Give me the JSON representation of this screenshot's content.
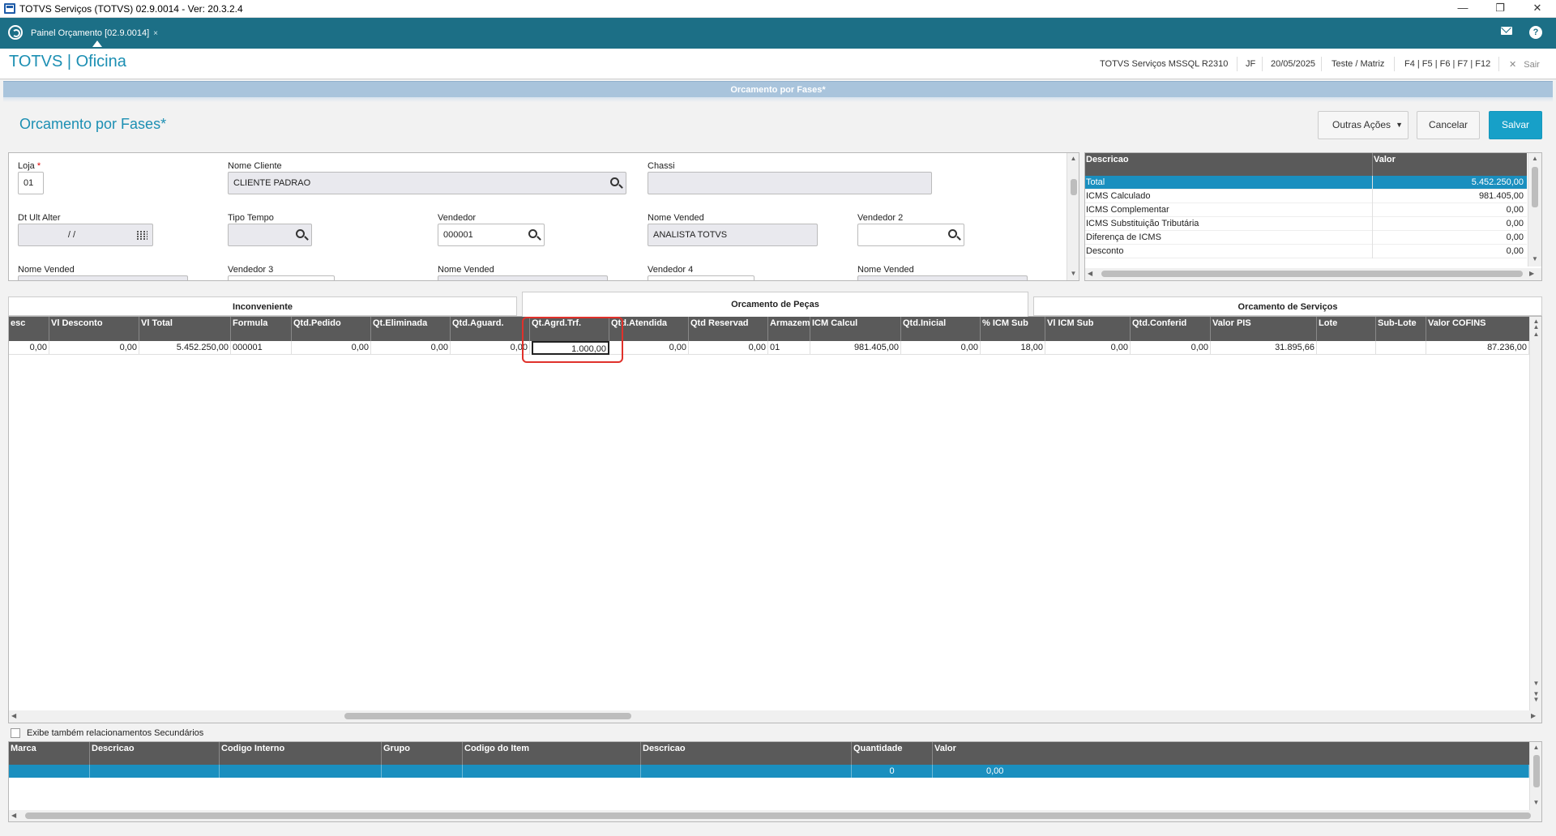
{
  "window": {
    "title": "TOTVS Serviços (TOTVS) 02.9.0014 - Ver: 20.3.2.4",
    "minimize": "—",
    "maximize": "❐",
    "close": "✕"
  },
  "tabbar": {
    "tab_label": "Painel Orçamento [02.9.0014]",
    "tab_close": "×"
  },
  "header": {
    "brand": "TOTVS | Oficina",
    "environment": "TOTVS Serviços MSSQL R2310",
    "user": "JF",
    "date": "20/05/2025",
    "company": "Teste / Matriz",
    "shortcuts": "F4 | F5 | F6 | F7 | F12",
    "exit_label": "Sair"
  },
  "form": {
    "strip_title": "Orcamento por Fases*",
    "title": "Orcamento por Fases*",
    "other_actions": "Outras Ações",
    "cancel": "Cancelar",
    "save": "Salvar",
    "fields": {
      "loja_label": "Loja",
      "loja_required": "*",
      "loja_value": "01",
      "nome_cliente_label": "Nome Cliente",
      "nome_cliente_value": "CLIENTE PADRAO",
      "chassi_label": "Chassi",
      "chassi_value": "",
      "dt_ult_alter_label": "Dt Ult Alter",
      "dt_ult_alter_value": "/ /",
      "tipo_tempo_label": "Tipo Tempo",
      "vendedor_label": "Vendedor",
      "vendedor_value": "000001",
      "nome_vended_label": "Nome Vended",
      "nome_vended_value": "ANALISTA TOTVS",
      "vendedor2_label": "Vendedor 2",
      "nome_vended2_label": "Nome Vended",
      "vendedor3_label": "Vendedor 3",
      "nome_vended3_label": "Nome Vended",
      "vendedor4_label": "Vendedor 4",
      "nome_vended4_label": "Nome Vended"
    }
  },
  "summary": {
    "headers": [
      "Descricao",
      "Valor"
    ],
    "rows": [
      {
        "desc": "Total",
        "value": "5.452.250,00"
      },
      {
        "desc": "ICMS Calculado",
        "value": "981.405,00"
      },
      {
        "desc": "ICMS Complementar",
        "value": "0,00"
      },
      {
        "desc": "ICMS Substituição Tributária",
        "value": "0,00"
      },
      {
        "desc": "Diferença de ICMS",
        "value": "0,00"
      },
      {
        "desc": "Desconto",
        "value": "0,00"
      }
    ]
  },
  "tabs": {
    "inconveniente": "Inconveniente",
    "pecas": "Orcamento de Peças",
    "servicos": "Orcamento de Serviços"
  },
  "grid": {
    "headers": [
      "esc",
      "Vl Desconto",
      "Vl Total",
      "Formula",
      "Qtd.Pedido",
      "Qt.Eliminada",
      "Qtd.Aguard.",
      "Qt.Agrd.Trf.",
      "Qtd.Atendida",
      "Qtd Reservad",
      "Armazem",
      "ICM Calcul",
      "Qtd.Inicial",
      "% ICM Sub",
      "Vl ICM Sub",
      "Qtd.Conferid",
      "Valor PIS",
      "Lote",
      "Sub-Lote",
      "Valor COFINS"
    ],
    "row": [
      "0,00",
      "0,00",
      "5.452.250,00",
      "000001",
      "0,00",
      "0,00",
      "0,00",
      "1.000,00",
      "0,00",
      "0,00",
      "01",
      "981.405,00",
      "0,00",
      "18,00",
      "0,00",
      "0,00",
      "31.895,66",
      "",
      "",
      "87.236,00"
    ]
  },
  "secondary": {
    "checkbox_label": "Exibe também relacionamentos Secundários",
    "headers": [
      "Marca",
      "Descricao",
      "Codigo Interno",
      "Grupo",
      "Codigo do Item",
      "Descricao",
      "Quantidade",
      "Valor"
    ],
    "row": [
      "",
      "",
      "",
      "",
      "",
      "",
      "0",
      "0,00"
    ]
  },
  "colors": {
    "teal": "#1c6f86",
    "accent": "#1c8fb3",
    "selection": "#1a8fbf",
    "highlight": "#e0312b"
  }
}
